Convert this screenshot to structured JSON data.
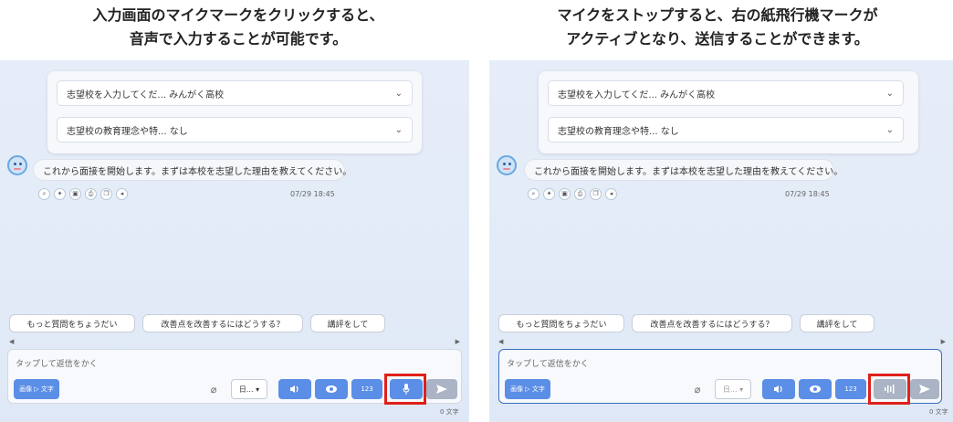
{
  "captions": {
    "left_line1": "入力画面のマイクマークをクリックすると、",
    "left_line2": "音声で入力することが可能です。",
    "right_line1": "マイクをストップすると、右の紙飛行機マークが",
    "right_line2": "アクティブとなり、送信することができます。"
  },
  "form": {
    "dropdown1": "志望校を入力してくだ... みんがく高校",
    "dropdown2": "志望校の教育理念や特... なし"
  },
  "chat": {
    "message": "これから面接を開始します。まずは本校を志望した理由を教えてください。",
    "timestamp": "07/29 18:45"
  },
  "suggestions": [
    "もっと質問をちょうだい",
    "改善点を改善するにはどうする？",
    "講評をして"
  ],
  "input": {
    "placeholder": "タップして返信をかく",
    "image_to_text_label": "画像 ▷ 文字",
    "language_select": "日...",
    "number_button": "123",
    "char_count": "0 文字"
  },
  "colors": {
    "primary": "#5b8ee6",
    "highlight": "#e0201a",
    "disabled": "#aab4c4"
  },
  "icons": {
    "attach": "paperclip-icon",
    "speaker": "speaker-icon",
    "eye": "eye-icon",
    "mic": "mic-icon",
    "stop": "audio-wave-icon",
    "send": "paper-plane-icon"
  }
}
